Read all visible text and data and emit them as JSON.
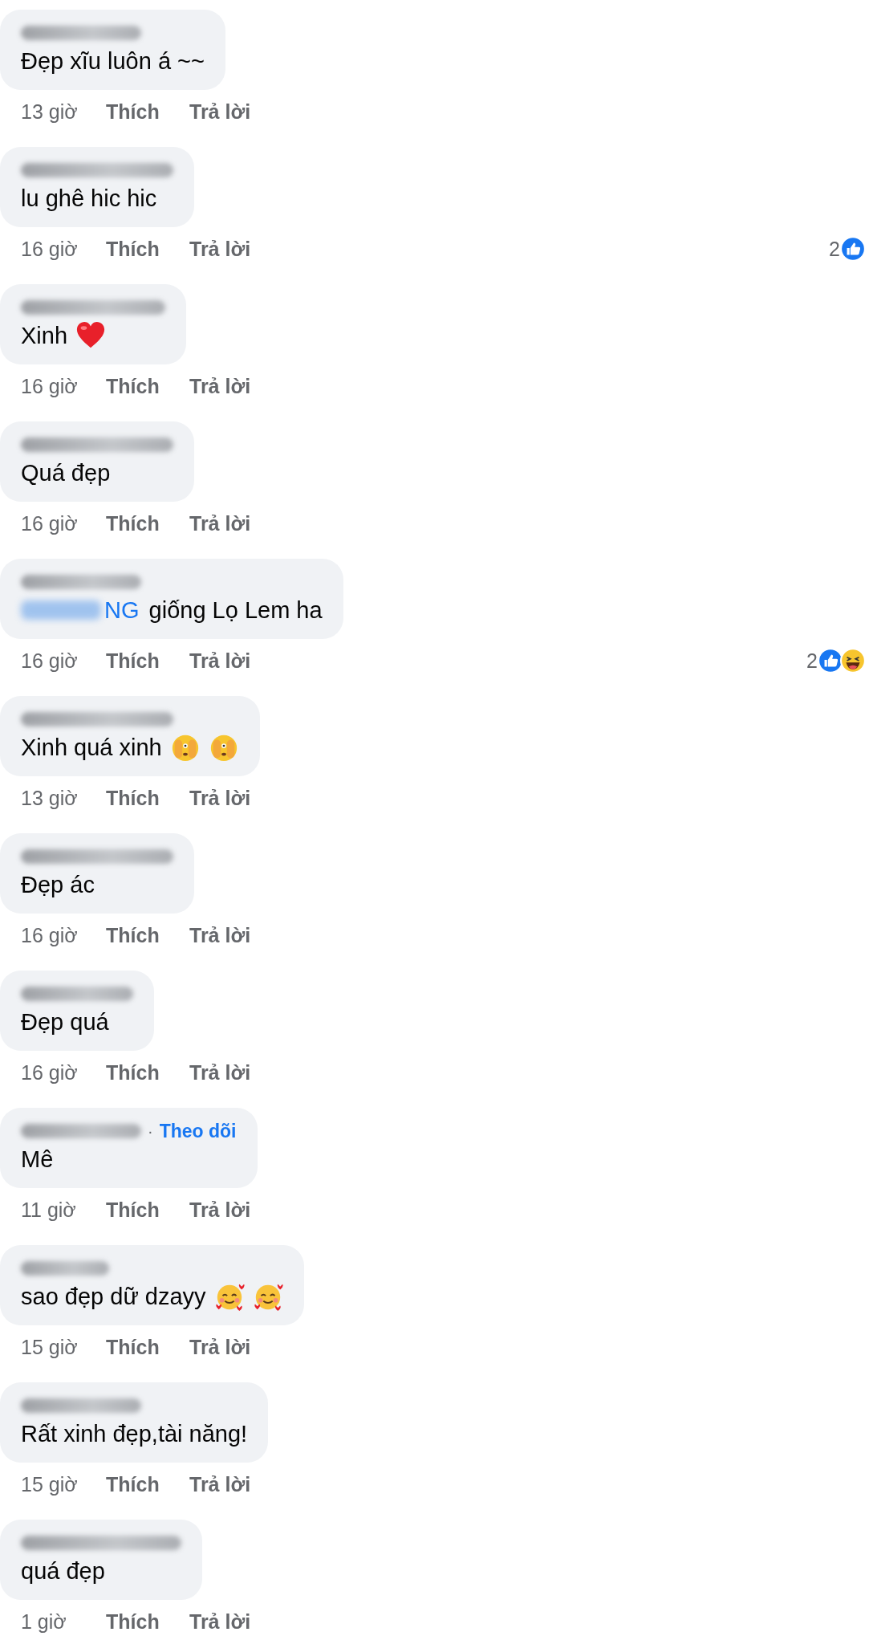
{
  "comments": [
    {
      "text": "Đẹp xĩu luôn á ~~",
      "time": "13 giờ",
      "like": "Thích",
      "reply": "Trả lời"
    },
    {
      "text": "lu ghê hic hic",
      "time": "16 giờ",
      "like": "Thích",
      "reply": "Trả lời",
      "reactions": {
        "count": "2",
        "types": [
          {
            "kind": "like"
          }
        ]
      }
    },
    {
      "text": "Xinh",
      "emojis": [
        {
          "kind": "heart"
        }
      ],
      "time": "16 giờ",
      "like": "Thích",
      "reply": "Trả lời"
    },
    {
      "text": "Quá đẹp",
      "time": "16 giờ",
      "like": "Thích",
      "reply": "Trả lời"
    },
    {
      "mention": "NG",
      "text": " giống Lọ Lem ha",
      "time": "16 giờ",
      "like": "Thích",
      "reply": "Trả lời",
      "reactions": {
        "count": "2",
        "types": [
          {
            "kind": "like"
          },
          {
            "kind": "haha"
          }
        ]
      }
    },
    {
      "text": "Xinh quá xinh",
      "emojis": [
        {
          "kind": "peek"
        },
        {
          "kind": "peek"
        }
      ],
      "time": "13 giờ",
      "like": "Thích",
      "reply": "Trả lời"
    },
    {
      "text": "Đẹp ác",
      "time": "16 giờ",
      "like": "Thích",
      "reply": "Trả lời"
    },
    {
      "text": "Đẹp quá",
      "time": "16 giờ",
      "like": "Thích",
      "reply": "Trả lời"
    },
    {
      "separator": "·",
      "follow": "Theo dõi",
      "text": "Mê",
      "time": "11 giờ",
      "like": "Thích",
      "reply": "Trả lời"
    },
    {
      "text": "sao đẹp dữ dzayy",
      "emojis": [
        {
          "kind": "hearts-face"
        },
        {
          "kind": "hearts-face"
        }
      ],
      "time": "15 giờ",
      "like": "Thích",
      "reply": "Trả lời"
    },
    {
      "text": "Rất xinh đẹp,tài năng!",
      "time": "15 giờ",
      "like": "Thích",
      "reply": "Trả lời"
    },
    {
      "text": "quá đẹp",
      "time": "1 giờ",
      "like": "Thích",
      "reply": "Trả lời"
    }
  ]
}
